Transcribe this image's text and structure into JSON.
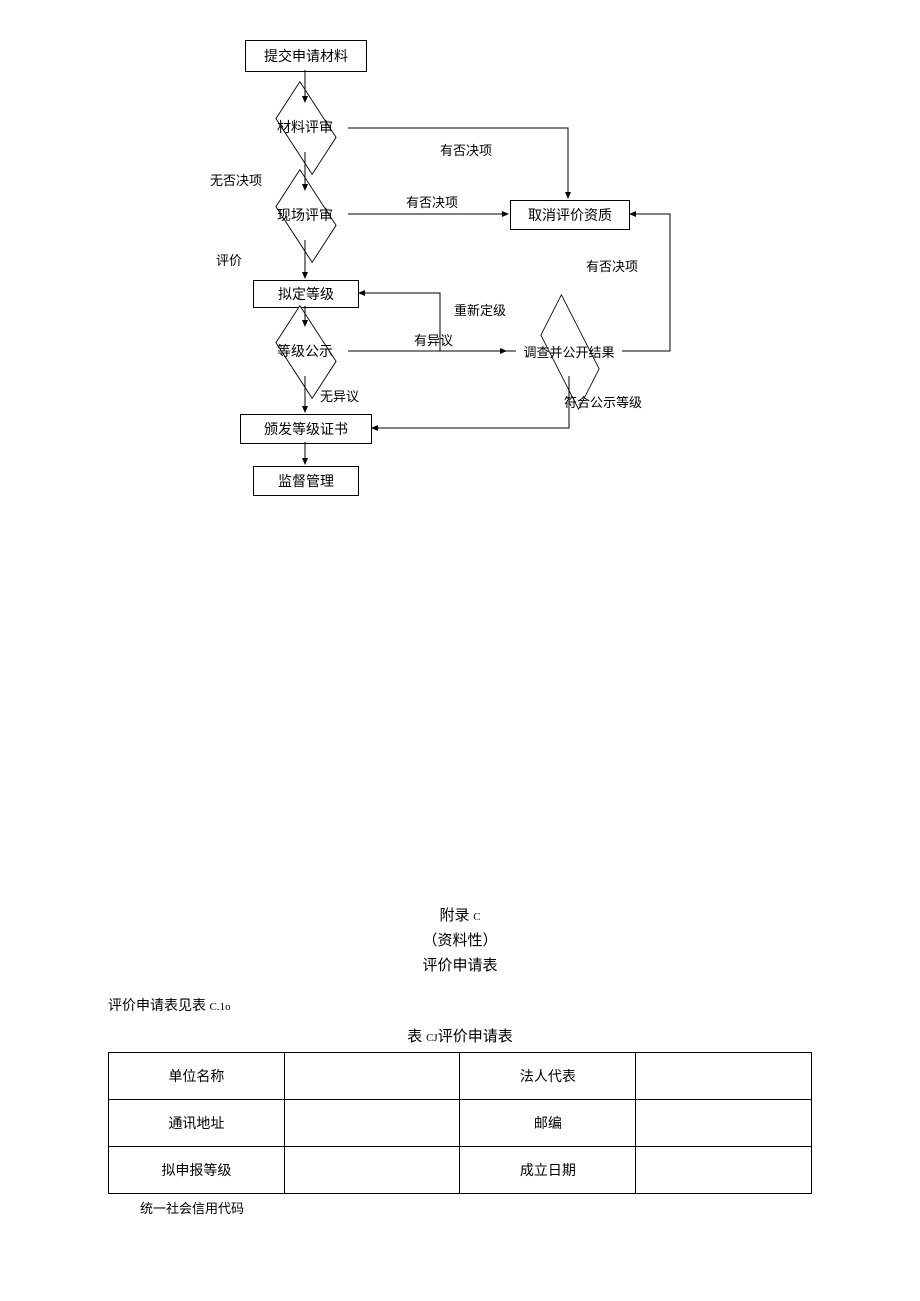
{
  "flow": {
    "n1": "提交申请材料",
    "n2": "材料评审",
    "n3": "现场评审",
    "n4": "拟定等级",
    "n5": "等级公示",
    "n6": "颁发等级证书",
    "n7": "监督管理",
    "n8": "取消评价资质",
    "n9": "调查并公开结果",
    "e1": "有否决项",
    "e2": "无否决项",
    "e3": "有否决项",
    "e4": "评价",
    "e5": "有否决项",
    "e6": "重新定级",
    "e7": "有异议",
    "e8": "无异议",
    "e9": "符合公示等级"
  },
  "appendix": {
    "title1": "附录",
    "title1_sub": "C",
    "title2": "（资料性）",
    "title3": "评价申请表"
  },
  "body_prefix": "评价申请表见表 ",
  "body_sub": "C.1o",
  "table_title_prefix": "表 ",
  "table_title_sub": "CJ",
  "table_title_suffix": "评价申请表",
  "form": {
    "r1c1": "单位名称",
    "r1c3": "法人代表",
    "r2c1": "通讯地址",
    "r2c3": "邮编",
    "r3c1": "拟申报等级",
    "r3c3": "成立日期",
    "below": "统一社会信用代码"
  }
}
